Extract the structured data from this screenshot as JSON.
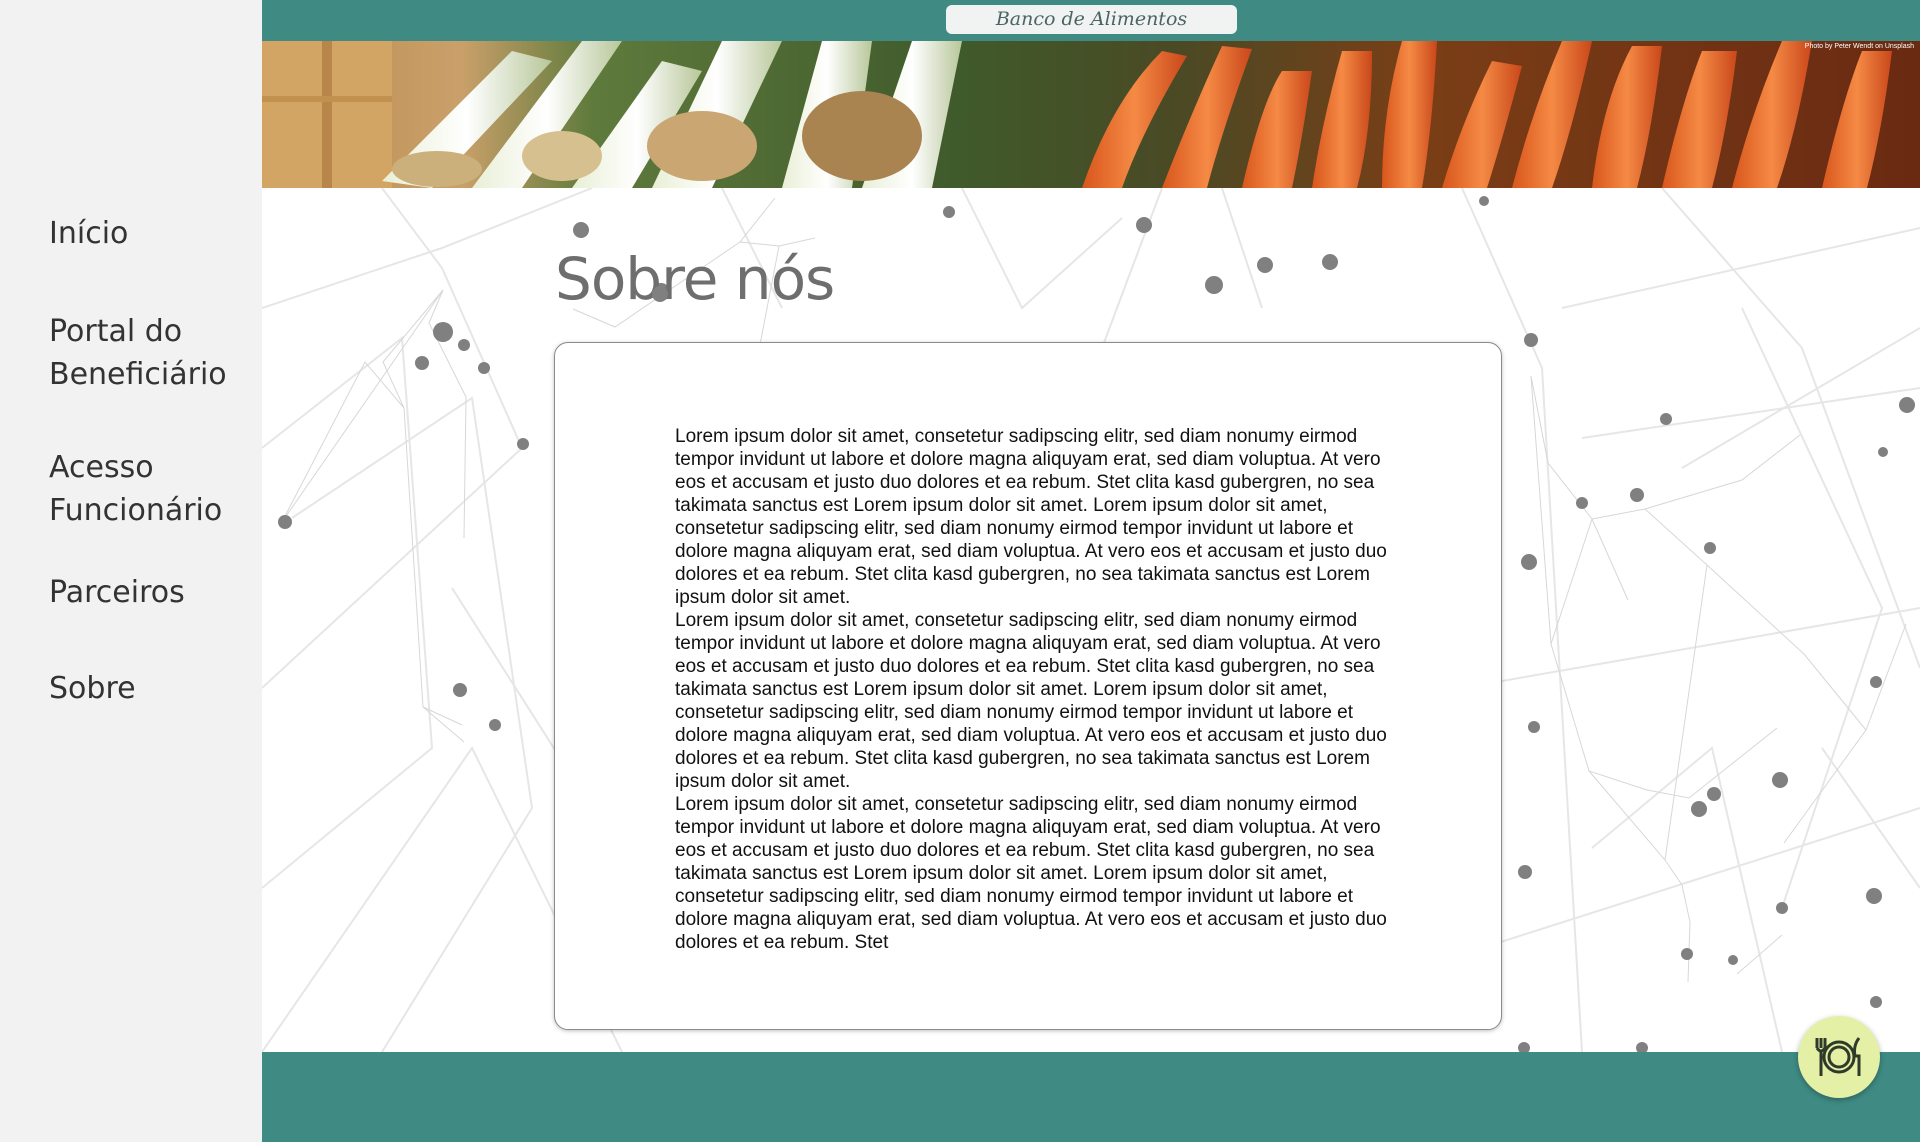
{
  "sidebar": {
    "items": [
      {
        "label": "Início"
      },
      {
        "label": "Portal do Beneficiário"
      },
      {
        "label": "Acesso Funcionário"
      },
      {
        "label": "Parceiros"
      },
      {
        "label": "Sobre"
      }
    ]
  },
  "header": {
    "brand": "Banco de Alimentos",
    "photo_credit": "Photo by Peter Wendt on Unsplash"
  },
  "main": {
    "title": "Sobre nós",
    "paragraphs": [
      "Lorem ipsum dolor sit amet, consetetur sadipscing elitr, sed diam nonumy eirmod tempor invidunt ut labore et dolore magna aliquyam erat, sed diam voluptua. At vero eos et accusam et justo duo dolores et ea rebum. Stet clita kasd gubergren, no sea takimata sanctus est Lorem ipsum dolor sit amet. Lorem ipsum dolor sit amet, consetetur sadipscing elitr, sed diam nonumy eirmod tempor invidunt ut labore et dolore magna aliquyam erat, sed diam voluptua. At vero eos et accusam et justo duo dolores et ea rebum. Stet clita kasd gubergren, no sea takimata sanctus est Lorem ipsum dolor sit amet.",
      "Lorem ipsum dolor sit amet, consetetur sadipscing elitr, sed diam nonumy eirmod tempor invidunt ut labore et dolore magna aliquyam erat, sed diam voluptua. At vero eos et accusam et justo duo dolores et ea rebum. Stet clita kasd gubergren, no sea takimata sanctus est Lorem ipsum dolor sit amet. Lorem ipsum dolor sit amet, consetetur sadipscing elitr, sed diam nonumy eirmod tempor invidunt ut labore et dolore magna aliquyam erat, sed diam voluptua. At vero eos et accusam et justo duo dolores et ea rebum. Stet clita kasd gubergren, no sea takimata sanctus est Lorem ipsum dolor sit amet.",
      "Lorem ipsum dolor sit amet, consetetur sadipscing elitr, sed diam nonumy eirmod tempor invidunt ut labore et dolore magna aliquyam erat, sed diam voluptua. At vero eos et accusam et justo duo dolores et ea rebum. Stet clita kasd gubergren, no sea takimata sanctus est Lorem ipsum dolor sit amet. Lorem ipsum dolor sit amet, consetetur sadipscing elitr, sed diam nonumy eirmod tempor invidunt ut labore et dolore magna aliquyam erat, sed diam voluptua. At vero eos et accusam et justo duo dolores et ea rebum. Stet"
    ]
  },
  "fab": {
    "icon": "plate-cutlery-icon"
  },
  "colors": {
    "accent": "#3f8b84",
    "sidebar_bg": "#f2f2f2",
    "fab_bg": "#e4f0a6",
    "node": "#808080"
  }
}
